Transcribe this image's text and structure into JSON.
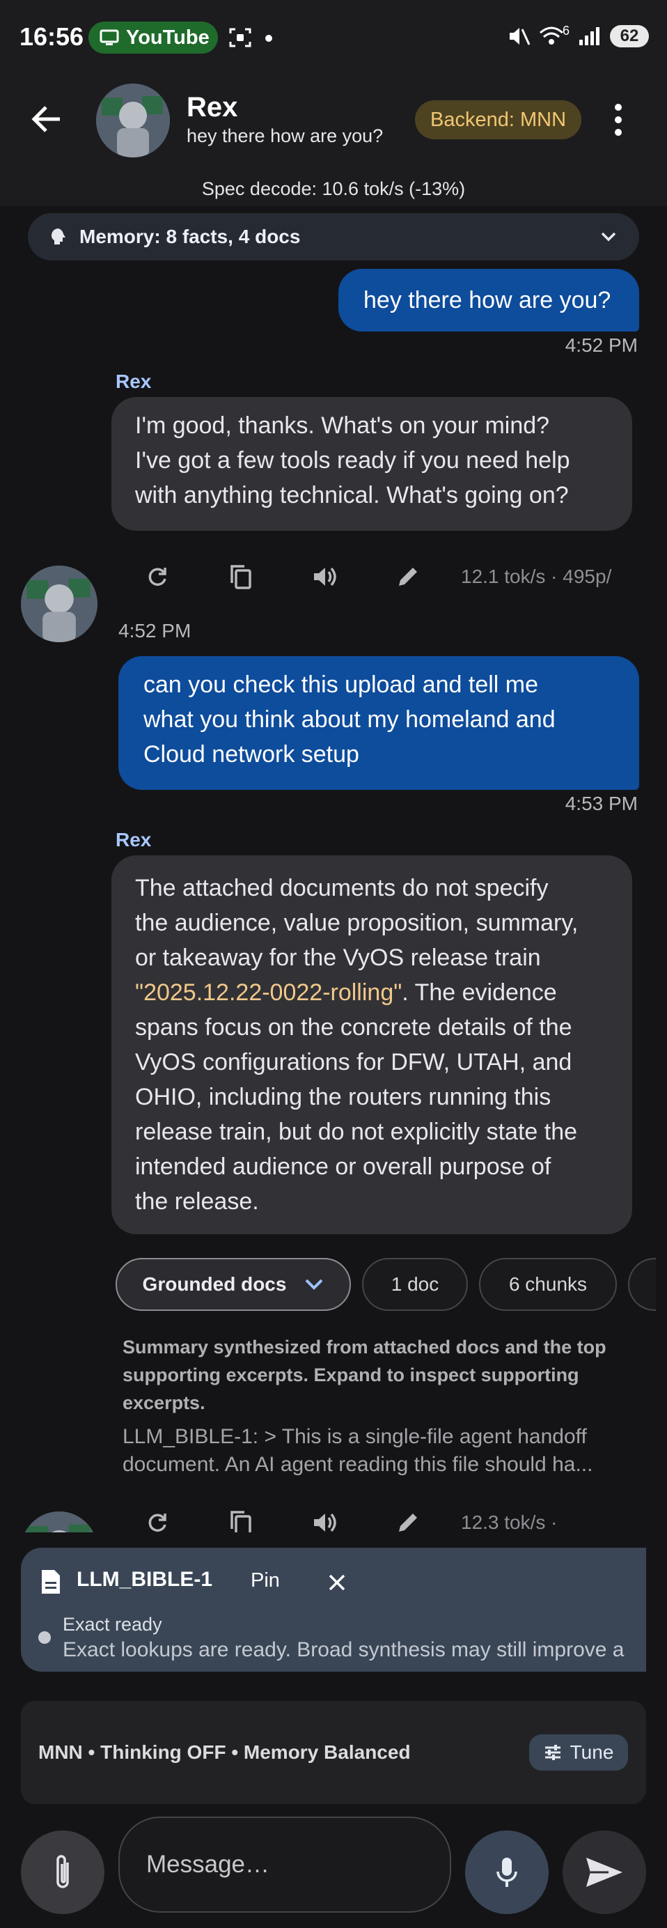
{
  "status_bar": {
    "time": "16:56",
    "activity_label": "YouTube",
    "network_type": "6",
    "battery": "62"
  },
  "header": {
    "name": "Rex",
    "subtitle": "hey there how are you?",
    "backend_badge": "Backend: MNN",
    "spec_decode": "Spec decode: 10.6 tok/s (-13%)"
  },
  "memory": {
    "label": "Memory: 8 facts, 4 docs"
  },
  "messages": [
    {
      "role": "user",
      "text": "hey there how are you?",
      "time": "4:52 PM"
    },
    {
      "role": "assistant",
      "sender": "Rex",
      "lines": [
        "I'm good, thanks. What's on your mind?",
        "I've got a few tools ready if you need help",
        "with anything technical. What's going on?"
      ],
      "stats": "12.1 tok/s · 495p/",
      "time": "4:52 PM"
    },
    {
      "role": "user",
      "lines": [
        "can you check this upload and tell me",
        "what you think about my homeland and",
        "Cloud network setup"
      ],
      "time": "4:53 PM"
    },
    {
      "role": "assistant",
      "sender": "Rex",
      "lines": [
        "The attached documents do not specify",
        "the audience, value proposition, summary,",
        "or takeaway for the VyOS release train",
        "spans focus on the concrete details of the",
        "VyOS configurations for DFW, UTAH, and",
        "OHIO, including the routers running this",
        "release train, but do not explicitly state the",
        "intended audience or overall purpose of",
        "the release."
      ],
      "highlight": "\"2025.12.22-0022-rolling\"",
      "highlight_tail": ". The evidence",
      "chips": [
        "Grounded docs",
        "1 doc",
        "6 chunks"
      ],
      "note_lines": [
        "Summary synthesized from attached docs and the top",
        "supporting excerpts. Expand to inspect supporting",
        "excerpts."
      ],
      "excerpt_lines": [
        "LLM_BIBLE-1: > This is a single-file agent handoff",
        "document. An AI agent reading this file should ha..."
      ],
      "stats": "12.3 tok/s ·"
    }
  ],
  "attachment": {
    "title": "LLM_BIBLE-1",
    "pin_label": "Pin",
    "status_title": "Exact ready",
    "status_desc": "Exact lookups are ready. Broad synthesis may still improve a"
  },
  "settings": {
    "label": "MNN • Thinking OFF • Memory Balanced",
    "tune_label": "Tune"
  },
  "composer": {
    "placeholder": "Message…"
  },
  "colors": {
    "user_bubble": "#0e4c9c",
    "assistant_bubble": "#323236",
    "backend_badge_bg": "#4e4321",
    "highlight": "#f1c88a",
    "sender": "#a8c8ff"
  }
}
